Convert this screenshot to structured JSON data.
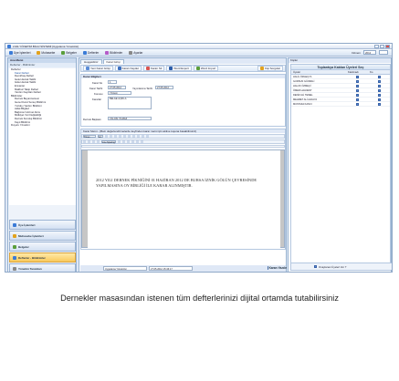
{
  "window": {
    "title": "LIVE YÖNETİM BİLGİ SİSTEMİ [Uygulama Yöneticisi]"
  },
  "menu": {
    "items": [
      {
        "label": "Üye İşlemleri",
        "icon": "users-icon",
        "color": "#3b7bd6"
      },
      {
        "label": "Muhasebe",
        "icon": "coins-icon",
        "color": "#e2a21d"
      },
      {
        "label": "Belgeler",
        "icon": "document-icon",
        "color": "#5a9e3a"
      },
      {
        "label": "Defterler",
        "icon": "book-icon",
        "color": "#3b7bd6"
      },
      {
        "label": "Bildirimler",
        "icon": "bell-icon",
        "color": "#b55bc8"
      },
      {
        "label": "Ayarlar",
        "icon": "gear-icon",
        "color": "#888888"
      }
    ],
    "right_label": "Dönem",
    "right_value": "2012"
  },
  "sidebar": {
    "title": "Ana Menü",
    "subtitle": "Defterler - Bildirimler",
    "tree": [
      "Defterler",
      "Karar Defteri",
      "Demirbaş Defteri",
      "Gelen Evrak Takibi",
      "Giden Evrak Takibi",
      "Envanter",
      "Makbuz Takip Defteri",
      "Yardım Kayıtları Defteri",
      "Bildirimler",
      "Dernek Beyannamesi",
      "Genel Kurul Sonuç Bildirimi",
      "Yurtdışı Yardım Bildirimi",
      "Aidat Bilgileri",
      "Bağımsız Hizmet Alımı",
      "Mülkiyet Yeri Değişikliği",
      "Dernek Kuruluş Bildirimi",
      "Kayıt Bildirimi",
      "Duyuru Yönetimi"
    ],
    "nav": [
      {
        "label": "Üye İşlemleri",
        "icon": "users-icon",
        "active": false
      },
      {
        "label": "Muhasebe İşlemleri",
        "icon": "coins-icon",
        "active": false
      },
      {
        "label": "Belgeler",
        "icon": "document-icon",
        "active": false
      },
      {
        "label": "Defterler - Bildirimler",
        "icon": "book-icon",
        "active": true
      },
      {
        "label": "Yönetim Tanımları",
        "icon": "gear-icon",
        "active": false
      }
    ]
  },
  "main": {
    "tabs": [
      "Hoşgeldiniz",
      "Karar Girişi"
    ],
    "toolbar": [
      {
        "label": "Yeni Karar Girişi",
        "icon": "new-icon"
      },
      {
        "label": "Kararı Kaydet",
        "icon": "save-icon"
      },
      {
        "label": "Kararı Sil",
        "icon": "delete-icon"
      },
      {
        "label": "Word Export",
        "icon": "word-icon"
      },
      {
        "label": "Word Import",
        "icon": "import-icon"
      }
    ],
    "toolbar_right": "Kişi Sorgular",
    "info": {
      "title": "Karar Bilgileri",
      "karar_no_label": "Karar No",
      "karar_no": "1",
      "karar_tarihi_label": "Karar Tarihi",
      "karar_tarihi": "27.05.2012",
      "yayinlanma_label": "Yayınlanma Tarihi",
      "yayinlanma": "27.05.2012",
      "konusu_label": "Konusu",
      "konusu": "Yöntem",
      "kararlar_label": "Kararlar",
      "kararlar": "BELGE AÇIKLA",
      "baskan_label": "Dernek Başkanı",
      "baskan": "YALÇIN YILMAZ"
    },
    "editor": {
      "header": "Karar Metni - (Bazı değerlendirmelerde keyfinden karar metni için aktive tuşuna basabilirsiniz)",
      "font": "Times",
      "size": "12",
      "style": "Line Spacing",
      "text": "2012 YILI DERNEK PİKNİĞİNİ 01 HAZİRAN 2012 DE BURSA İZNİK GÖLÜN ÇEVRESİNDE YAPILMASINA OY BİRLİĞİ İLE KARAR ALINMIŞTIR."
    },
    "status": {
      "user": "Uygulama Yöneticisi",
      "datetime": "27.05.2012 15:46:17"
    },
    "print_label": "Kararı Yazdır"
  },
  "right_panel": {
    "title": "Kişiler",
    "header": "Toplantıya Katılan Üyeleri Seç",
    "col_name": "Üyeler",
    "col_katildi": "Katılmadı",
    "col_karar": "Ko",
    "rows": [
      "HALİL ÖZGEÇYA",
      "GURSUN GÜVENLİ",
      "HALUK ÖZMEÇİ",
      "ÖMER HALDENT",
      "DENİZ ALİ TEMEL",
      "MEHMET ALİ ALDAYA",
      "MUSTAFA KANCI"
    ],
    "footer": "Onaylanan Üyeleri Ver ?"
  },
  "caption": "Dernekler masasından istenen tüm defterlerinizi dijital ortamda tutabilirsiniz"
}
